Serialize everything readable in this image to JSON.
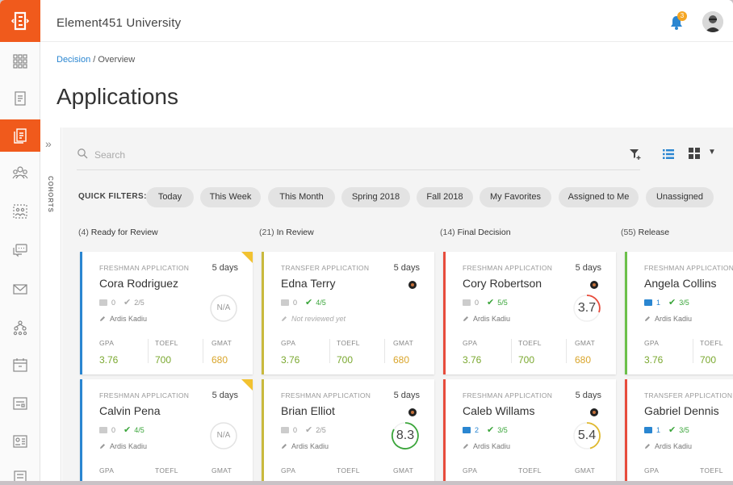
{
  "app": {
    "title": "Element451 University",
    "notification_count": "3"
  },
  "breadcrumb": {
    "link": "Decision",
    "separator": "/",
    "current": "Overview"
  },
  "page": {
    "title": "Applications"
  },
  "cohorts": {
    "label": "COHORTS",
    "expand_icon": "double-chevron-right-icon"
  },
  "search": {
    "placeholder": "Search",
    "value": ""
  },
  "quick_filters": {
    "label": "QUICK FILTERS:",
    "items": [
      "Today",
      "This Week",
      "This Month",
      "Spring 2018",
      "Fall 2018",
      "My Favorites",
      "Assigned to Me",
      "Unassigned"
    ]
  },
  "columns": [
    {
      "count": "(4)",
      "label": "Ready for Review"
    },
    {
      "count": "(21)",
      "label": "In Review"
    },
    {
      "count": "(14)",
      "label": "Final Decision"
    },
    {
      "count": "(55)",
      "label": "Release"
    }
  ],
  "stat_labels": {
    "gpa": "GPA",
    "toefl": "TOEFL",
    "gmat": "GMAT"
  },
  "cards": [
    {
      "type": "FRESHMAN APPLICATION",
      "days": "5 days",
      "name": "Cora Rodriguez",
      "mail": "0",
      "checks": "2/5",
      "reviewer": "Ardis Kadiu",
      "score": "N/A",
      "gpa": "3.76",
      "toefl": "700",
      "gmat": "680"
    },
    {
      "type": "TRANSFER APPLICATION",
      "days": "5 days",
      "name": "Edna Terry",
      "mail": "0",
      "checks": "4/5",
      "reviewer": "Not reviewed yet",
      "score": "",
      "gpa": "3.76",
      "toefl": "700",
      "gmat": "680"
    },
    {
      "type": "FRESHMAN APPLICATION",
      "days": "5 days",
      "name": "Cory Robertson",
      "mail": "0",
      "checks": "5/5",
      "reviewer": "Ardis Kadiu",
      "score": "3.7",
      "gpa": "3.76",
      "toefl": "700",
      "gmat": "680"
    },
    {
      "type": "FRESHMAN APPLICATION",
      "days": "",
      "name": "Angela Collins",
      "mail": "1",
      "checks": "3/5",
      "reviewer": "Ardis Kadiu",
      "score": "",
      "gpa": "3.76",
      "toefl": "700",
      "gmat": ""
    },
    {
      "type": "FRESHMAN APPLICATION",
      "days": "5 days",
      "name": "Calvin Pena",
      "mail": "0",
      "checks": "4/5",
      "reviewer": "Ardis Kadiu",
      "score": "N/A",
      "gpa": "",
      "toefl": "",
      "gmat": ""
    },
    {
      "type": "FRESHMAN APPLICATION",
      "days": "5 days",
      "name": "Brian Elliot",
      "mail": "0",
      "checks": "2/5",
      "reviewer": "Ardis Kadiu",
      "score": "8.3",
      "gpa": "",
      "toefl": "",
      "gmat": ""
    },
    {
      "type": "FRESHMAN APPLICATION",
      "days": "5 days",
      "name": "Caleb Willams",
      "mail": "2",
      "checks": "3/5",
      "reviewer": "Ardis Kadiu",
      "score": "5.4",
      "gpa": "",
      "toefl": "",
      "gmat": ""
    },
    {
      "type": "TRANSFER APPLICATION",
      "days": "",
      "name": "Gabriel Dennis",
      "mail": "1",
      "checks": "3/5",
      "reviewer": "Ardis Kadiu",
      "score": "",
      "gpa": "",
      "toefl": "",
      "gmat": ""
    }
  ],
  "colors": {
    "brand": "#f05a1c",
    "link": "#2a86d1",
    "accent_yellow": "#c9b93e",
    "accent_red": "#e74c3c",
    "accent_green": "#6cc04a"
  }
}
